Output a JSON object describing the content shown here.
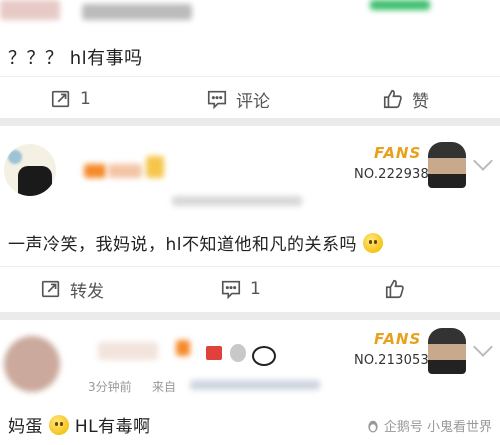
{
  "post1": {
    "text": "？？？ hl有事吗",
    "repost_count": "1",
    "comment_label": "评论",
    "like_label": "赞"
  },
  "post2": {
    "text": "一声冷笑，我妈说，hl不知道他和凡的关系吗",
    "fans_label": "FANS",
    "fans_no": "NO.222938",
    "repost_label": "转发",
    "like_count": "1"
  },
  "post3": {
    "time": "3分钟前",
    "source": "来自",
    "fans_label": "FANS",
    "fans_no": "NO.213053",
    "text_pre": "妈蛋",
    "text_post": "HL有毒啊"
  },
  "watermark": "企鹅号 小鬼看世界",
  "icons": [
    "repost-icon",
    "comment-icon",
    "like-icon",
    "chevron-down-icon",
    "smile-emoji-icon",
    "penguin-logo-icon"
  ]
}
